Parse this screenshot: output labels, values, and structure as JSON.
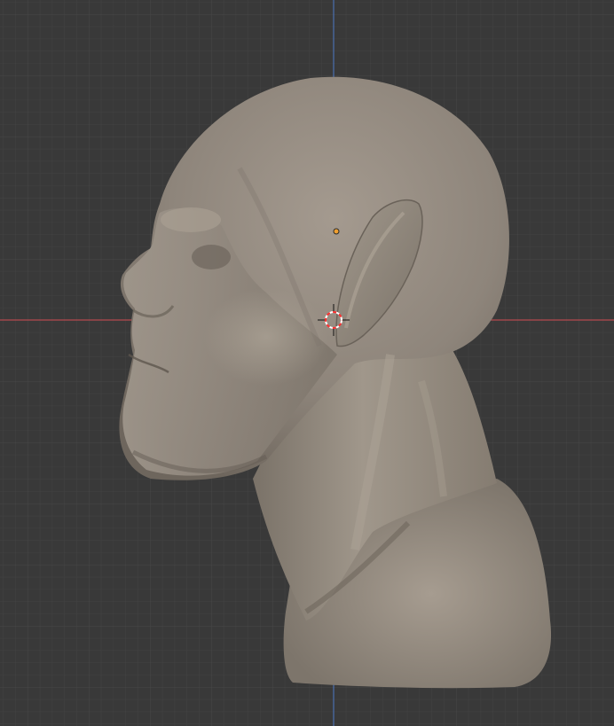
{
  "viewport": {
    "view": "right-orthographic",
    "mode": "sculpt",
    "background_color": "#393939",
    "grid_minor_color": "#424242",
    "grid_major_color": "#4a4a4a",
    "x_axis_color": "#b54a4f",
    "z_axis_color": "#4a6fb0",
    "mesh_color": "#8e857b"
  },
  "scene_objects": [
    {
      "name": "head-bust-mesh",
      "type": "sculpted-mesh"
    },
    {
      "name": "object-origin",
      "type": "origin-point",
      "color": "#f0a030"
    },
    {
      "name": "3d-cursor",
      "type": "cursor",
      "colors": [
        "#ff3030",
        "#ffffff"
      ]
    }
  ]
}
